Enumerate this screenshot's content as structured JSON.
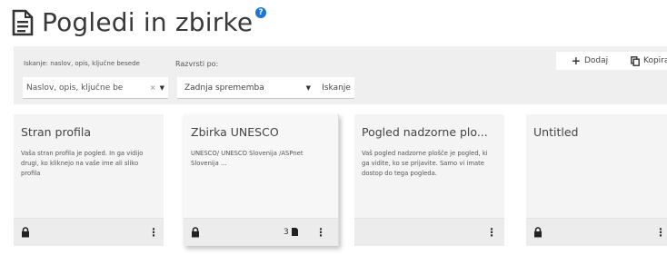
{
  "page": {
    "title": "Pogledi in zbirke",
    "info_badge": "?"
  },
  "toolbar": {
    "search_label": "Iskanje: naslov, opis, ključne besede",
    "sort_label": "Razvrsti po:",
    "search_value": "Naslov, opis, ključne be",
    "clear_glyph": "×",
    "sort_value": "Zadnja sprememba",
    "search_button": "Iskanje",
    "add_button": "Dodaj",
    "copy_button": "Kopiraj"
  },
  "cards": [
    {
      "title": "Stran profila",
      "description": "Vaša stran profila je pogled. In ga vidijo drugi, ko kliknejo na vaše ime ali sliko profila",
      "locked": true,
      "count": null
    },
    {
      "title": "Zbirka UNESCO",
      "description": "UNESCO/ UNESCO Slovenija /ASPnet Slovenija ...",
      "locked": true,
      "count": "3"
    },
    {
      "title": "Pogled nadzorne plo...",
      "description": "Vaš pogled nadzorne plošče je pogled, ki ga vidite, ko se prijavite. Samo vi imate dostop do tega pogleda.",
      "locked": false,
      "count": null
    },
    {
      "title": "Untitled",
      "description": "",
      "locked": true,
      "count": null
    }
  ]
}
